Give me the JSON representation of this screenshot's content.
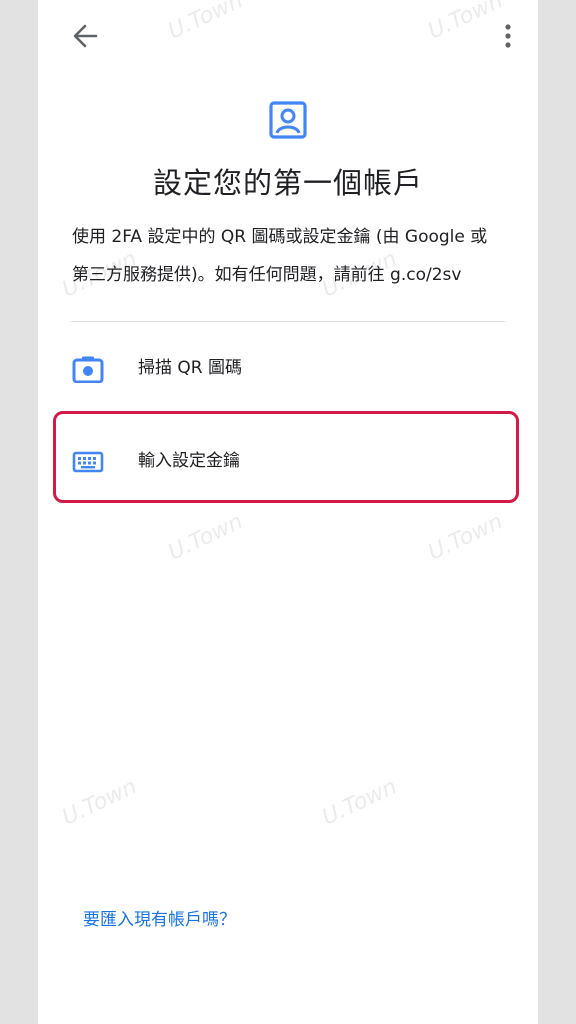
{
  "title": "設定您的第一個帳戶",
  "description_line1": "使用 2FA 設定中的 QR 圖碼或設定金鑰 (由 Google 或",
  "description_line2": "第三方服務提供)。如有任何問題，請前往 g.co/2sv",
  "options": [
    {
      "label": "掃描 QR 圖碼",
      "icon": "camera-icon"
    },
    {
      "label": "輸入設定金鑰",
      "icon": "keyboard-icon"
    }
  ],
  "import_link": "要匯入現有帳戶嗎？",
  "watermark": "U.Town",
  "colors": {
    "accent": "#1a73e8",
    "highlight": "#d11a47",
    "text": "#202124"
  }
}
